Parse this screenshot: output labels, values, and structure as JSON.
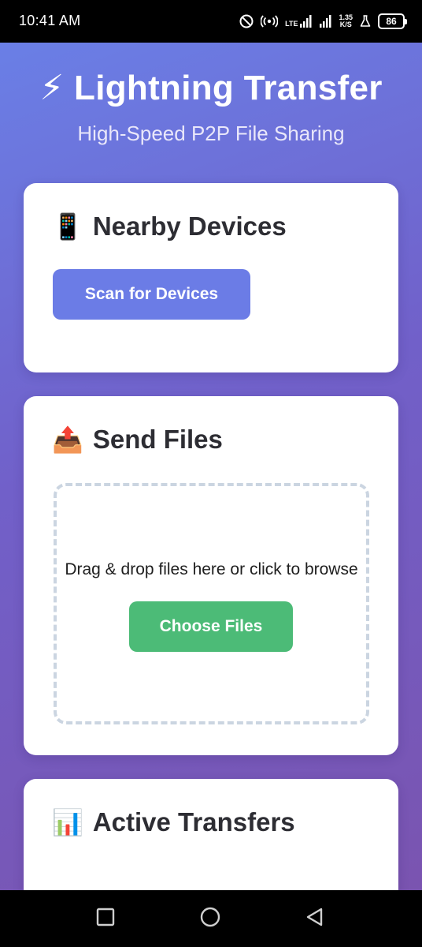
{
  "status_bar": {
    "time": "10:41 AM",
    "network_label": "LTE",
    "speed_value": "1.35",
    "speed_unit": "K/S",
    "battery": "86",
    "icons": [
      "dnd-icon",
      "hotspot-icon",
      "signal-icon",
      "signal-icon",
      "flask-icon",
      "battery-icon"
    ]
  },
  "header": {
    "emoji": "⚡",
    "title": "Lightning Transfer",
    "subtitle": "High-Speed P2P File Sharing"
  },
  "devices_card": {
    "emoji": "📱",
    "title": "Nearby Devices",
    "scan_button": "Scan for Devices"
  },
  "send_card": {
    "emoji": "📤",
    "title": "Send Files",
    "drop_text": "Drag & drop files here or click to browse",
    "choose_button": "Choose Files"
  },
  "transfers_card": {
    "emoji": "📊",
    "title": "Active Transfers"
  },
  "colors": {
    "gradient_start": "#6a7fe6",
    "gradient_end": "#7a54b0",
    "scan_button": "#6b7ce6",
    "choose_button": "#4cbb77"
  },
  "nav_bar": {
    "icons": [
      "recents-icon",
      "home-icon",
      "back-icon"
    ]
  }
}
